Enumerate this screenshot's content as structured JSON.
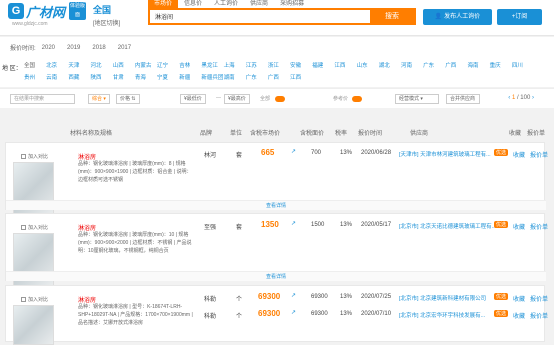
{
  "header": {
    "logo_mark": "G",
    "logo_name": "广材网",
    "logo_url": "www.gldzjc.com",
    "logo_badge": "体验版面",
    "region_name": "全国",
    "region_switch": "[地区切换]",
    "tabs": [
      "市场价",
      "信息价",
      "人工询价",
      "供应商",
      "采购招募"
    ],
    "search_value": "淋浴间",
    "search_button": "搜索",
    "publish_button": "发布人工询价",
    "subscribe_button": "+订阅"
  },
  "filters": {
    "year_label": "报价时间:",
    "years": [
      "2020",
      "2019",
      "2018",
      "2017"
    ],
    "region_label": "地 区：",
    "regions": [
      "全国",
      "北京",
      "天津",
      "河北",
      "山西",
      "内蒙古",
      "辽宁",
      "吉林",
      "黑龙江",
      "上海",
      "江苏",
      "浙江",
      "安徽",
      "福建",
      "江西",
      "山东",
      "湖北",
      "河南",
      "广东",
      "广西",
      "海南",
      "重庆",
      "四川",
      "贵州",
      "云南",
      "西藏",
      "陕西",
      "甘肃",
      "青海",
      "宁夏",
      "新疆",
      "新疆兵团",
      "湖南",
      "广东",
      "广西",
      "江西"
    ]
  },
  "toolbar": {
    "search_placeholder": "在结果中搜索",
    "sort_label": "综合",
    "price_label": "价格",
    "min_price": "最低价",
    "max_price": "最高价",
    "all_label": "全部",
    "ref_label": "参考价",
    "mode_label": "经营模式",
    "merge_label": "合并供应商",
    "pager_current": "1",
    "pager_total": "/ 100"
  },
  "table_headers": [
    "材料名称及规格",
    "品牌",
    "单位",
    "含税市场价",
    "含税面价",
    "税率",
    "报价时间",
    "供应商",
    "收藏",
    "报价单"
  ],
  "products": [
    {
      "add_compare": "加入对比",
      "name_prefix": "淋浴",
      "name_hl": "房",
      "desc": "品种：钢化玻璃淋浴房 | 玻璃厚度(mm)：8 | 规格(mm)：900×900×1900 | 边框材质：铝合金 | 说明：边框材质可选不锈钢",
      "brand": "林河",
      "unit": "套",
      "price": "665",
      "trend": "↗",
      "face_price": "700",
      "tax": "13%",
      "date": "2020/06/28",
      "supplier": "[天津市] 天津市林河建筑玻璃工程有...",
      "yx": "优选",
      "fav": "收藏",
      "quote": "报价单",
      "more": "查看详情"
    },
    {
      "add_compare": "加入对比",
      "name_prefix": "淋浴",
      "name_hl": "房",
      "desc": "品种：钢化玻璃淋浴房 | 玻璃厚度(mm)：10 | 规格(mm)：900×900×2000 | 边框材质：不锈钢 | 产品说明：10厘钢化玻璃，不锈钢框，纯铜合页",
      "brand": "至强",
      "unit": "套",
      "price": "1350",
      "trend": "↗",
      "face_price": "1500",
      "tax": "13%",
      "date": "2020/05/17",
      "supplier": "[北京市] 北京天诺比德建筑玻璃工程有...",
      "yx": "优选",
      "fav": "收藏",
      "quote": "报价单",
      "more": "查看详情"
    },
    {
      "add_compare": "加入对比",
      "name_prefix": "淋浴",
      "name_hl": "房",
      "desc": "品种：钢化玻璃淋浴房 | 型号：K-18674T-LRH-SHP+18029T-NA | 产品规格：1700×700×1900mm | 品名描述：艾娜开放式淋浴房",
      "brand": "科勒",
      "unit": "个",
      "price": "69300",
      "trend": "↗",
      "face_price": "69300",
      "tax": "13%",
      "date": "2020/07/25",
      "supplier": "[北京市] 北京建筑新科建材有限公司",
      "yx": "优选",
      "fav": "收藏",
      "quote": "报价单",
      "price2": "69300",
      "face_price2": "69300",
      "date2": "2020/07/10",
      "supplier2": "[北京市] 北京宏华环宇科技发展有...",
      "brand2": "科勒",
      "unit2": "个"
    }
  ],
  "colors": {
    "accent": "#ff7e00",
    "brand": "#1a90d6",
    "highlight": "#ee0000"
  }
}
